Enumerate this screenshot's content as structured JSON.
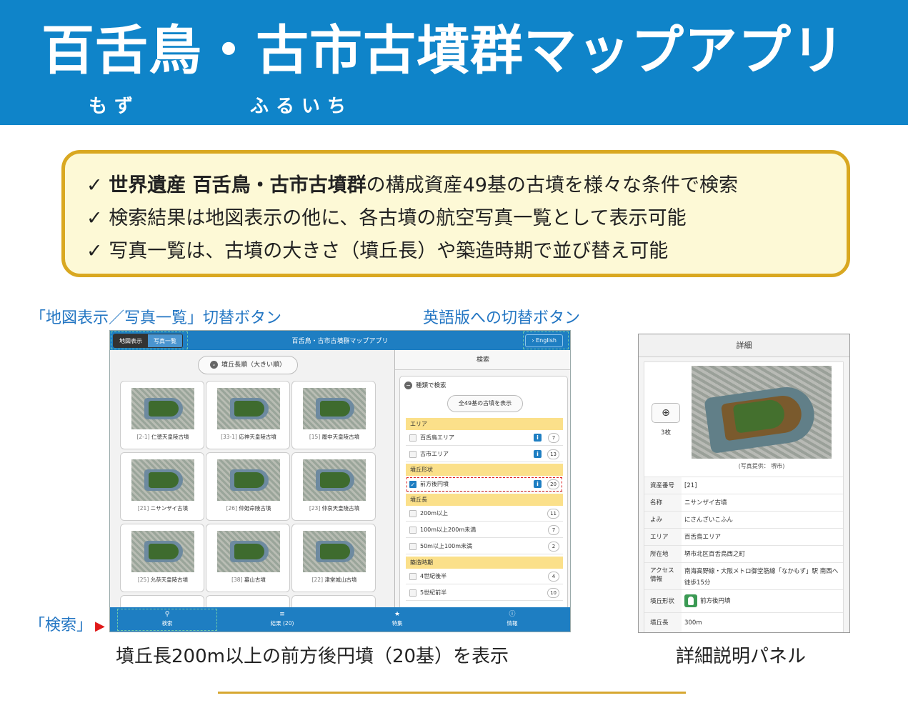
{
  "banner": {
    "title": "百舌鳥・古市古墳群マップアプリ",
    "ruby_mozu": "もず",
    "ruby_furuichi": "ふるいち"
  },
  "features": {
    "check": "✓",
    "line1_bold": "世界遺産  百舌鳥・古市古墳群",
    "line1_rest": "の構成資産49基の古墳を様々な条件で検索",
    "line2": "検索結果は地図表示の他に、各古墳の航空写真一覧として表示可能",
    "line3": "写真一覧は、古墳の大きさ（墳丘長）や築造時期で並び替え可能"
  },
  "callouts": {
    "toggle": "「地図表示／写真一覧」切替ボタン",
    "english": "英語版への切替ボタン",
    "search": "「検索」",
    "search_arrow": "▶"
  },
  "app": {
    "title": "百舌鳥・古市古墳群マップアプリ",
    "toggle_map": "地図表示",
    "toggle_photo": "写真一覧",
    "english_icon": "chevron-right-icon",
    "english_glyph": "›",
    "english": "English",
    "sort_label": "墳丘長順（大きい順）",
    "sort_icon_glyph": "⌄",
    "tiles": [
      {
        "num": "[2-1]",
        "name": "仁徳天皇陵古墳"
      },
      {
        "num": "[33-1]",
        "name": "応神天皇陵古墳"
      },
      {
        "num": "[15]",
        "name": "履中天皇陵古墳"
      },
      {
        "num": "[21]",
        "name": "ニサンザイ古墳"
      },
      {
        "num": "[26]",
        "name": "仲姫命陵古墳"
      },
      {
        "num": "[23]",
        "name": "仲哀天皇陵古墳"
      },
      {
        "num": "[25]",
        "name": "允恭天皇陵古墳"
      },
      {
        "num": "[38]",
        "name": "墓山古墳"
      },
      {
        "num": "[22]",
        "name": "津堂城山古墳"
      }
    ],
    "search": {
      "header": "検索",
      "type_label": "種類で検索",
      "type_glyph": "−",
      "show_all": "全49基の古墳を表示",
      "sections": {
        "area": "エリア",
        "shape": "墳丘形状",
        "length": "墳丘長",
        "period": "築造時期"
      },
      "rows": {
        "mozu": {
          "label": "百舌鳥エリア",
          "count": "7"
        },
        "furuichi": {
          "label": "古市エリア",
          "count": "13"
        },
        "zenpo": {
          "label": "前方後円墳",
          "count": "20",
          "checked": true
        },
        "over200": {
          "label": "200m以上",
          "count": "11"
        },
        "m100_200": {
          "label": "100m以上200m未満",
          "count": "7"
        },
        "m50_100": {
          "label": "50m以上100m未満",
          "count": "2"
        },
        "c4late": {
          "label": "4世紀後半",
          "count": "4"
        },
        "c5early": {
          "label": "5世紀前半",
          "count": "10"
        }
      },
      "info_glyph": "i",
      "check_glyph": "✓"
    },
    "nav": {
      "search": {
        "label": "検索",
        "icon": "search-icon",
        "glyph": "⚲"
      },
      "results": {
        "label": "結果 (20)",
        "icon": "list-icon",
        "glyph": "≡"
      },
      "featured": {
        "label": "特集",
        "icon": "star-icon",
        "glyph": "★"
      },
      "info": {
        "label": "情報",
        "icon": "info-icon",
        "glyph": "ⓘ"
      }
    }
  },
  "detail": {
    "header": "詳細",
    "zoom_glyph": "⊕",
    "photo_count": "3枚",
    "photo_credit": "(写真提供： 堺市)",
    "rows": [
      {
        "key": "資産番号",
        "value": "[21]"
      },
      {
        "key": "名称",
        "value": "ニサンザイ古墳"
      },
      {
        "key": "よみ",
        "value": "にさんざいこふん"
      },
      {
        "key": "エリア",
        "value": "百舌鳥エリア"
      },
      {
        "key": "所在地",
        "value": "堺市北区百舌鳥西之町"
      },
      {
        "key": "アクセス情報",
        "value": "南海高野線・大阪メトロ御堂筋線「なかもず」駅 南西へ徒歩15分"
      },
      {
        "key": "墳丘形状",
        "value": "前方後円墳"
      },
      {
        "key": "墳丘長",
        "value": "300m"
      }
    ]
  },
  "captions": {
    "left": "墳丘長200m以上の前方後円墳（20基）を表示",
    "right": "詳細説明パネル"
  },
  "colors": {
    "banner": "#0f84c9",
    "app_blue": "#1e7ec2",
    "features_border": "#d9a821",
    "features_bg": "#fdf9d6",
    "section_yellow": "#fbe08a",
    "callout_blue": "#2376c3",
    "callout_arrow_red": "#e01919"
  }
}
